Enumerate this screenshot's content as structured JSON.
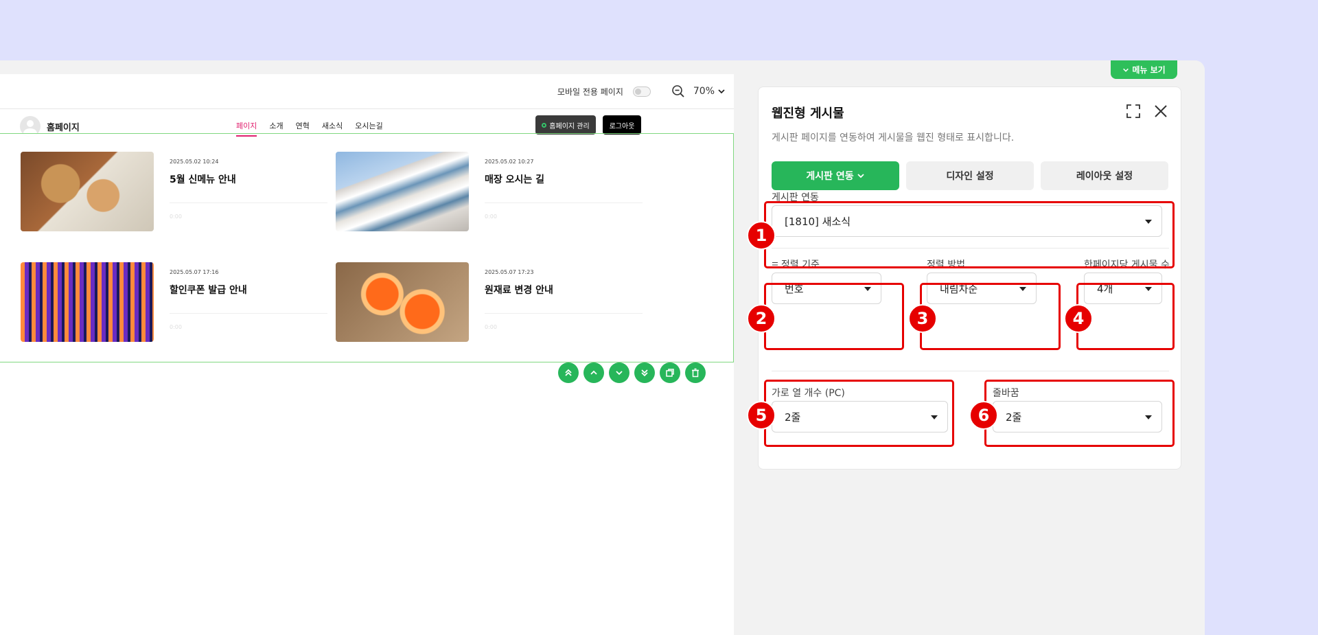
{
  "preview": {
    "mobile_only_label": "모바일 전용 페이지",
    "zoom": "70%",
    "site_name": "홈페이지",
    "nav": [
      "페이지",
      "소개",
      "연혁",
      "새소식",
      "오시는길"
    ],
    "manage_label": "홈페이지 관리",
    "logout_label": "로그아웃",
    "posts": [
      {
        "date": "2025.05.02 10:24",
        "title": "5월 신메뉴 안내",
        "meta": "0:00",
        "thumb": "bread-photo"
      },
      {
        "date": "2025.05.02 10:27",
        "title": "매장 오시는 길",
        "meta": "0:00",
        "thumb": "building-photo"
      },
      {
        "date": "2025.05.07 17:16",
        "title": "할인쿠폰 발급 안내",
        "meta": "0:00",
        "thumb": "neon-photo"
      },
      {
        "date": "2025.05.07 17:23",
        "title": "원재료 변경 안내",
        "meta": "0:00",
        "thumb": "fruit-photo"
      }
    ],
    "block_tools": [
      "move-top-icon",
      "move-up-icon",
      "move-down-icon",
      "move-bottom-icon",
      "copy-icon",
      "delete-icon"
    ]
  },
  "menu_tab": {
    "label": "메뉴 보기"
  },
  "panel": {
    "title": "웹진형 게시물",
    "description": "게시판 페이지를 연동하여 게시물을 웹진 형태로 표시합니다.",
    "tabs": [
      {
        "label": "게시판 연동",
        "active": true
      },
      {
        "label": "디자인 설정",
        "active": false
      },
      {
        "label": "레이아웃 설정",
        "active": false
      }
    ],
    "board_link": {
      "label": "게시판 연동",
      "value": "[1810] 새소식"
    },
    "sort_key": {
      "label": "정렬 기준",
      "value": "번호"
    },
    "sort_order": {
      "label": "정렬 방법",
      "value": "내림차순"
    },
    "per_page": {
      "label": "한페이지당 게시물 수",
      "value": "4개"
    },
    "columns_pc": {
      "label": "가로 열 개수 (PC)",
      "value": "2줄"
    },
    "wrap": {
      "label": "줄바꿈",
      "value": "2줄"
    }
  },
  "annotations": [
    "1",
    "2",
    "3",
    "4",
    "5",
    "6"
  ],
  "colors": {
    "accent": "#27b65a",
    "highlight": "#e60000",
    "nav_active": "#e0206e",
    "background": "#dfe1fd"
  }
}
